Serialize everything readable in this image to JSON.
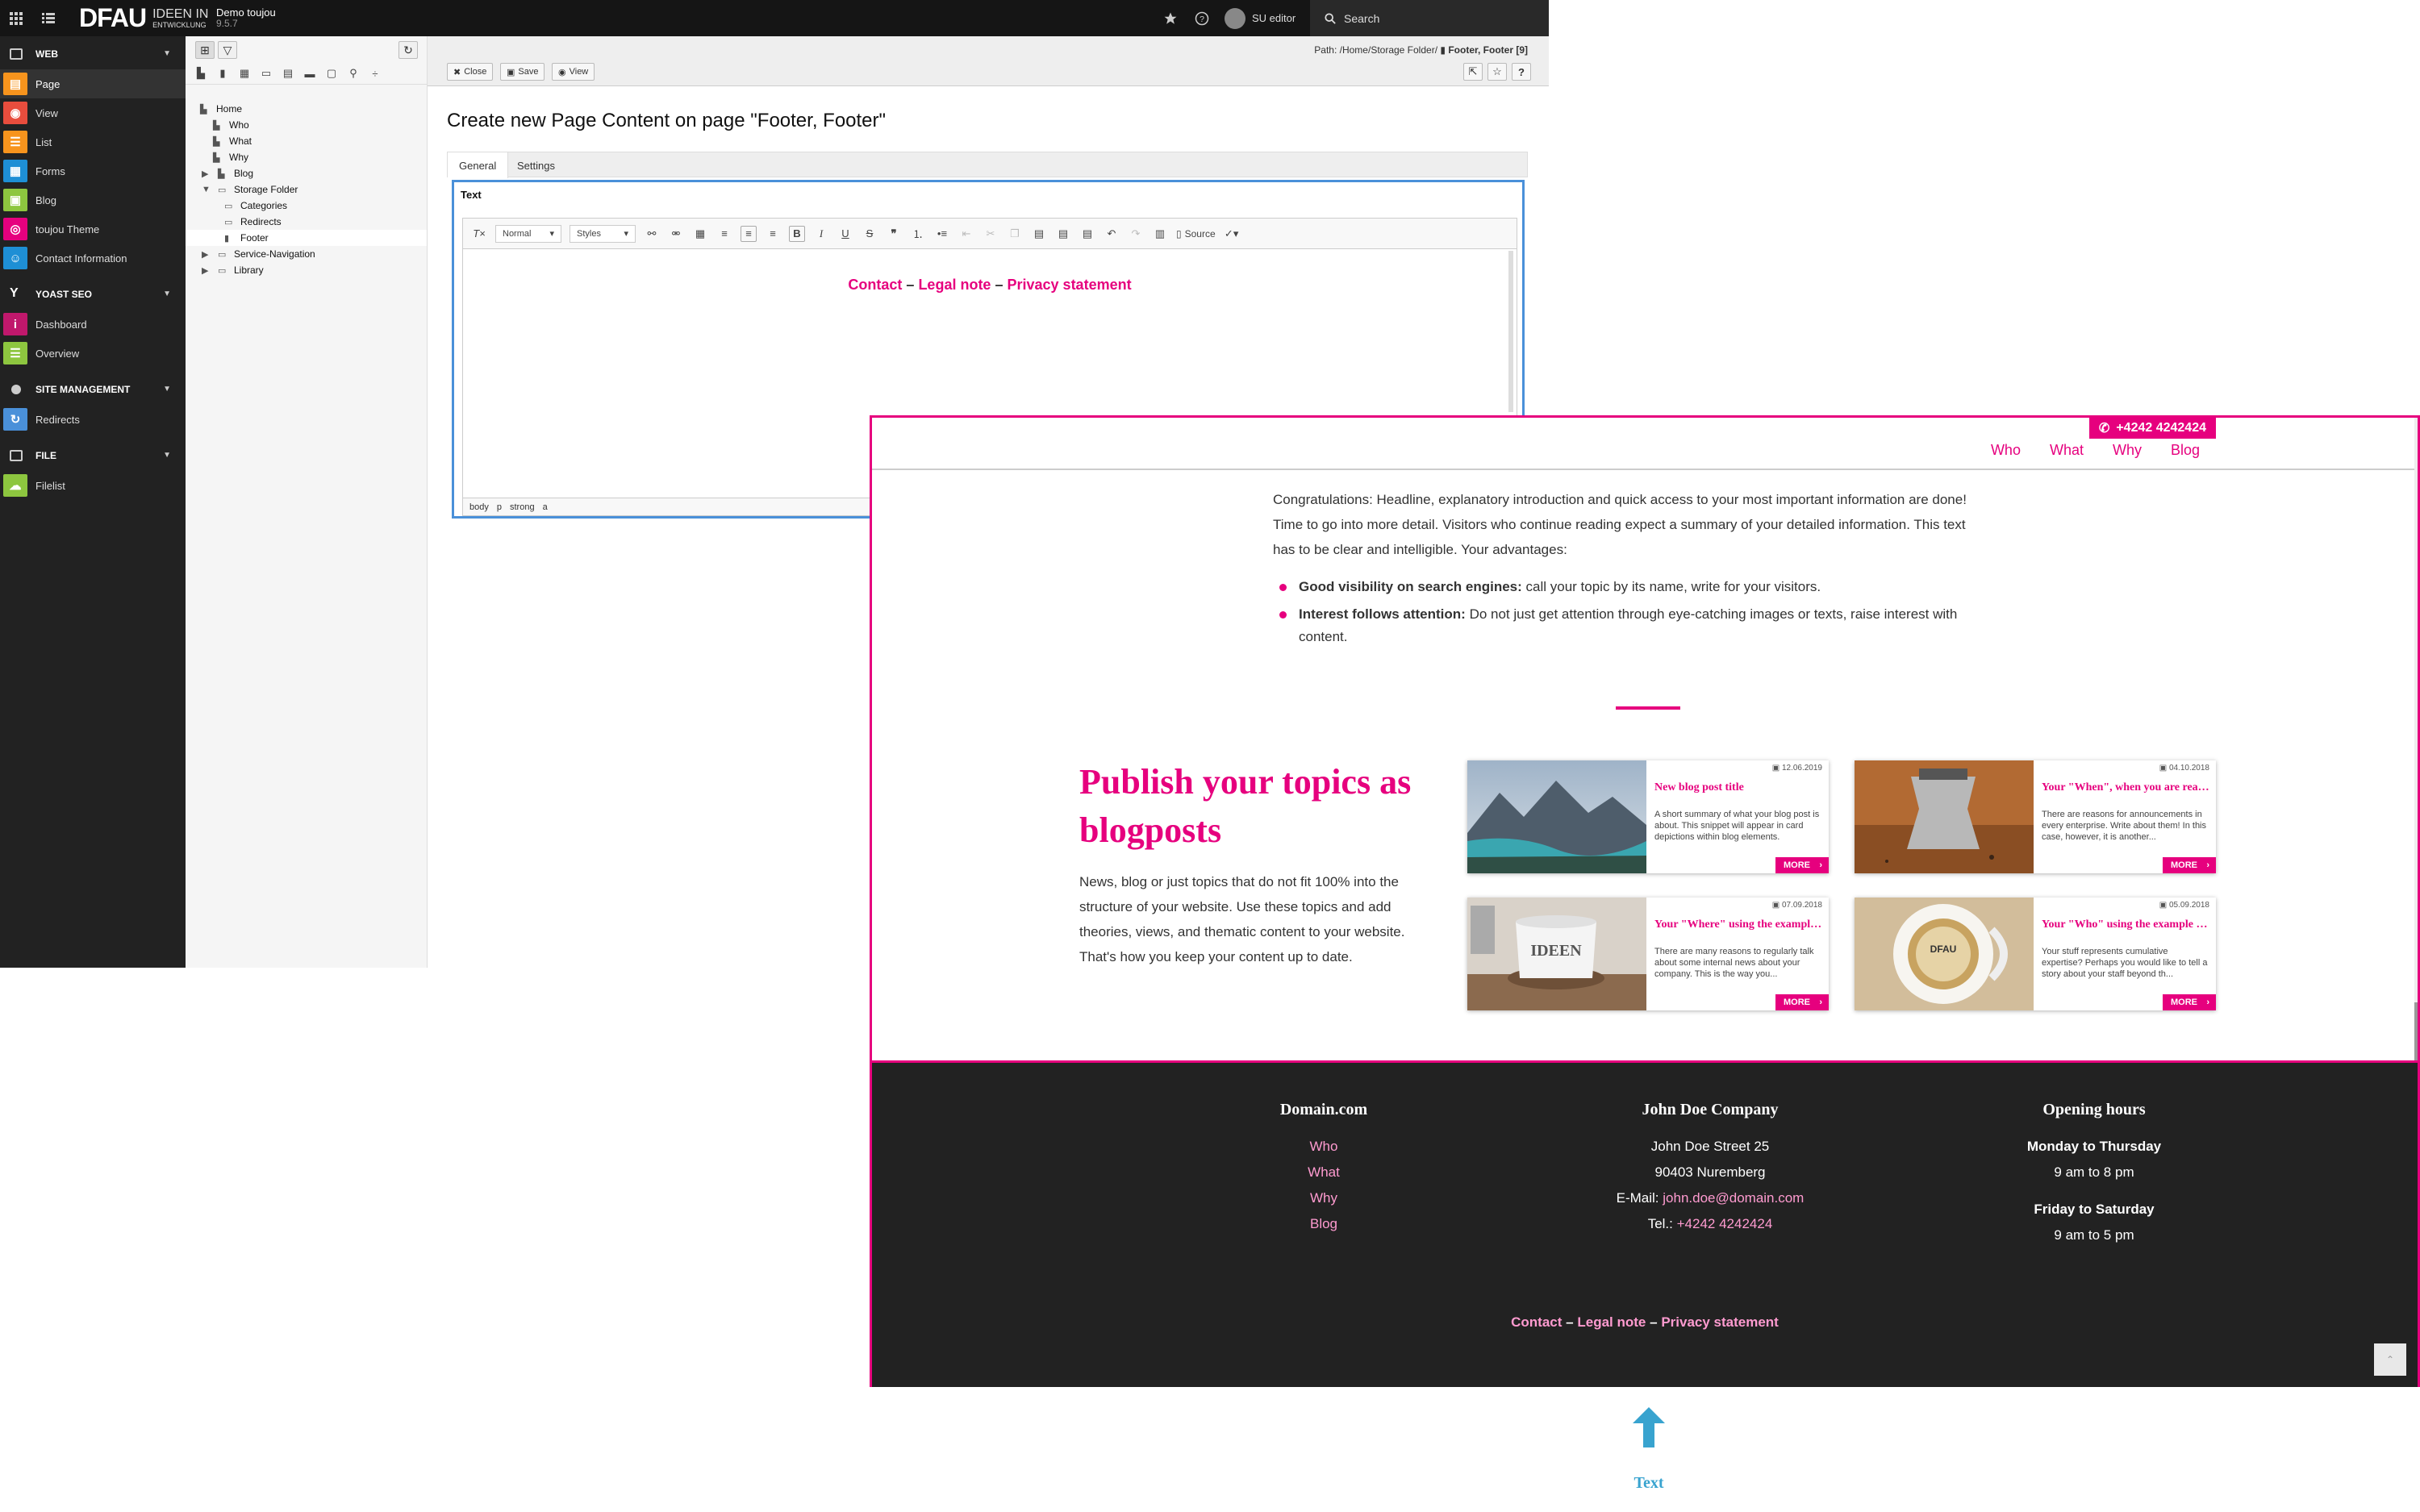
{
  "topbar": {
    "brand": "DFAU",
    "brand_sub1": "IDEEN IN",
    "brand_sub2": "ENTWICKLUNG",
    "site_title": "Demo toujou",
    "version": "9.5.7",
    "user": "SU editor",
    "search_label": "Search"
  },
  "modmenu": {
    "web": "WEB",
    "page": "Page",
    "view": "View",
    "list": "List",
    "forms": "Forms",
    "blog": "Blog",
    "theme": "toujou Theme",
    "contact": "Contact Information",
    "yoast": "YOAST SEO",
    "dashboard": "Dashboard",
    "overview": "Overview",
    "site_mgmt": "SITE MANAGEMENT",
    "redirects": "Redirects",
    "file": "FILE",
    "filelist": "Filelist"
  },
  "colors": {
    "page": "#f7941d",
    "view": "#e84d3d",
    "list": "#f7941d",
    "forms": "#1e8fd5",
    "blog": "#8dc63f",
    "theme": "#e6007e",
    "contact": "#1e8fd5",
    "dashboard": "#c0186c",
    "overview": "#8dc63f",
    "redirects": "#4a90d9",
    "filelist": "#8dc63f",
    "accent": "#e6007e"
  },
  "tree": {
    "home": "Home",
    "who": "Who",
    "what": "What",
    "why": "Why",
    "blog": "Blog",
    "storage": "Storage Folder",
    "categories": "Categories",
    "redirects": "Redirects",
    "footer": "Footer",
    "service": "Service-Navigation",
    "library": "Library"
  },
  "docheader": {
    "path_prefix": "Path: /Home/Storage Folder/",
    "path_page": "Footer, Footer [9]",
    "close": "Close",
    "save": "Save",
    "view": "View"
  },
  "editor": {
    "title": "Create new Page Content on page \"Footer, Footer\"",
    "tab_general": "General",
    "tab_settings": "Settings",
    "field_label": "Text",
    "format": "Normal",
    "styles": "Styles",
    "source": "Source",
    "link_contact": "Contact",
    "link_legal": "Legal note",
    "link_privacy": "Privacy statement",
    "sep": "–",
    "path1": "body",
    "path2": "p",
    "path3": "strong",
    "path4": "a"
  },
  "preview": {
    "phone": "+4242 4242424",
    "nav": [
      "Who",
      "What",
      "Why",
      "Blog"
    ],
    "intro": "Congratulations: Headline, explanatory introduction and quick access to your most important information are done! Time to go into more detail. Visitors who continue reading expect a summary of your detailed information. This text has to be clear and intelligible. Your advantages:",
    "b1_bold": "Good visibility on search engines:",
    "b1_text": " call your topic by its name, write for your visitors.",
    "b2_bold": "Interest follows attention:",
    "b2_text": " Do not just get attention through eye-catching images or texts, raise interest with content.",
    "pub_title": "Publish your topics as blogposts",
    "pub_text": "News, blog or just topics that do not fit 100% into the structure of your website. Use these topics and add theories, views, and thematic content to your website. That's how you keep your content up to date.",
    "more": "MORE",
    "cards": [
      {
        "date": "12.06.2019",
        "title": "New blog post title",
        "snippet": "A short summary of what your blog post is about. This snippet will appear in card depictions within blog elements."
      },
      {
        "date": "04.10.2018",
        "title": "Your \"When\", when you are ready",
        "snippet": "There are reasons for announcements in every enterprise. Write about them! In this case, however, it is another..."
      },
      {
        "date": "07.09.2018",
        "title": "Your \"Where\" using the example of our office",
        "snippet": "There are many reasons to regularly talk about some internal news about your company. This is the way you..."
      },
      {
        "date": "05.09.2018",
        "title": "Your \"Who\" using the example of your team",
        "snippet": "Your stuff represents cumulative expertise? Perhaps you would like to tell a story about your staff beyond th..."
      }
    ],
    "footer": {
      "col1_title": "Domain.com",
      "col1_links": [
        "Who",
        "What",
        "Why",
        "Blog"
      ],
      "col2_title": "John Doe Company",
      "street": "John Doe Street 25",
      "city": "90403 Nuremberg",
      "email_label": "E-Mail:",
      "email": "john.doe@domain.com",
      "tel_label": "Tel.:",
      "tel": "+4242 4242424",
      "col3_title": "Opening hours",
      "days1": "Monday to Thursday",
      "hours1": "9 am to 8 pm",
      "days2": "Friday to Saturday",
      "hours2": "9 am to 5 pm",
      "link_contact": "Contact",
      "link_legal": "Legal note",
      "link_privacy": "Privacy statement",
      "sep": "–"
    }
  },
  "annotation": {
    "label": "Text"
  }
}
